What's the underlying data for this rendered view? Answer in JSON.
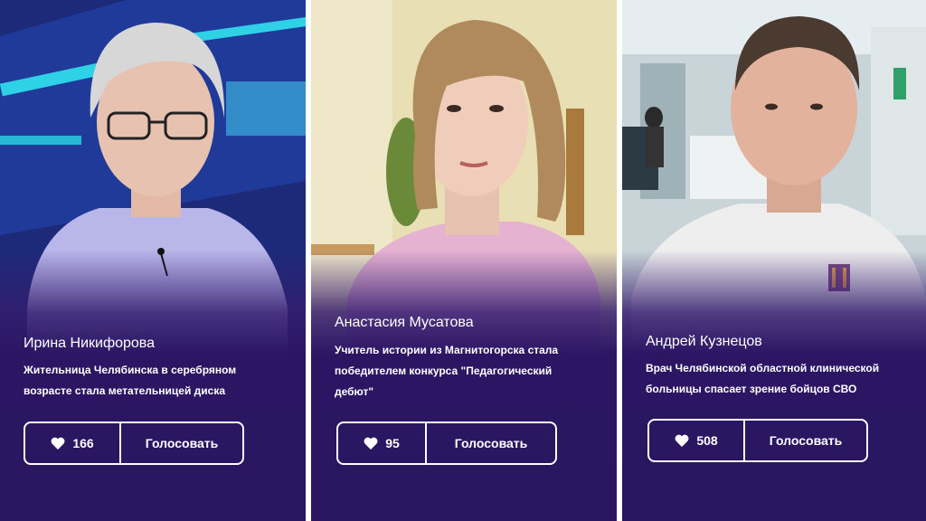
{
  "cards": [
    {
      "name": "Ирина Никифорова",
      "description": "Жительница Челябинска в серебряном возрасте стала метательницей диска",
      "likes": "166",
      "vote_label": "Голосовать"
    },
    {
      "name": "Анастасия Мусатова",
      "description": "Учитель истории из Магнитогорска стала победителем конкурса \"Педагогический дебют\"",
      "likes": "95",
      "vote_label": "Голосовать"
    },
    {
      "name": "Андрей Кузнецов",
      "description": "Врач Челябинской областной клинической больницы спасает зрение бойцов СВО",
      "likes": "508",
      "vote_label": "Голосовать"
    }
  ],
  "icons": {
    "like": "heart-icon"
  },
  "colors": {
    "card_background": "#2a1560",
    "text": "#ffffff",
    "button_border": "#ffffff"
  }
}
